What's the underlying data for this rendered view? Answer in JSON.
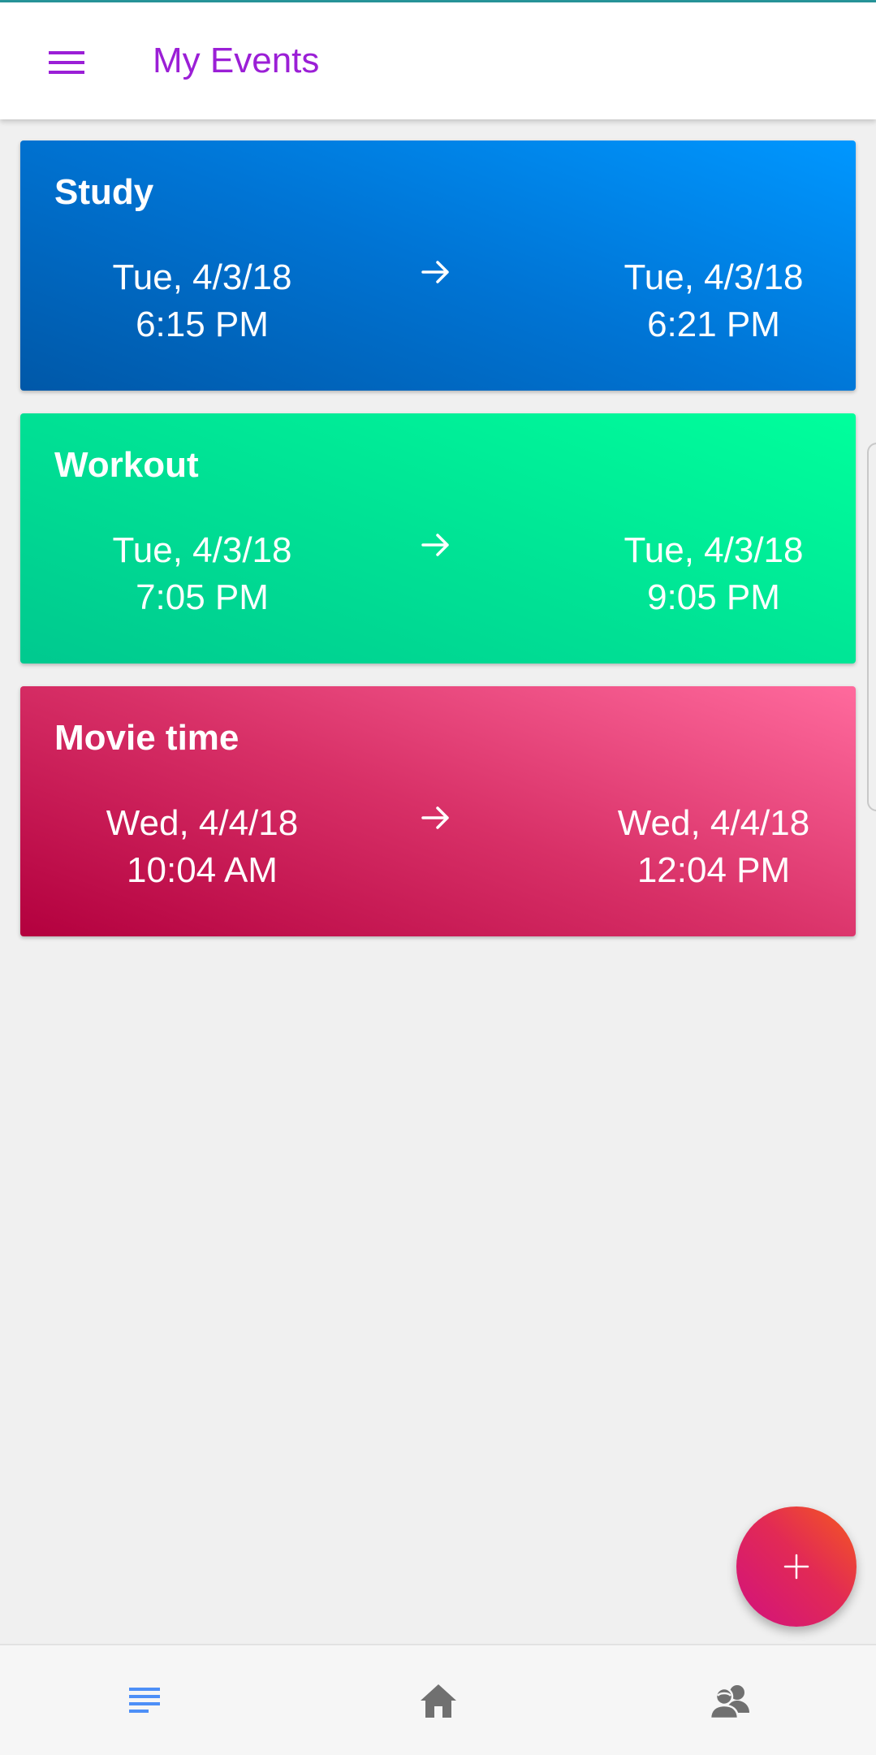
{
  "app_bar": {
    "title": "My Events",
    "menu_icon": "hamburger-menu-icon",
    "title_color": "#9b1fd6"
  },
  "events": [
    {
      "title": "Study",
      "start_date": "Tue, 4/3/18",
      "start_time": "6:15 PM",
      "end_date": "Tue, 4/3/18",
      "end_time": "6:21 PM",
      "colors": [
        "#0058a8",
        "#0097ff"
      ]
    },
    {
      "title": "Workout",
      "start_date": "Tue, 4/3/18",
      "start_time": "7:05 PM",
      "end_date": "Tue, 4/3/18",
      "end_time": "9:05 PM",
      "colors": [
        "#00c98f",
        "#00ff9c"
      ]
    },
    {
      "title": "Movie time",
      "start_date": "Wed, 4/4/18",
      "start_time": "10:04 AM",
      "end_date": "Wed, 4/4/18",
      "end_time": "12:04 PM",
      "colors": [
        "#b3003e",
        "#ff6a9d"
      ]
    }
  ],
  "fab": {
    "icon": "plus-icon",
    "colors": [
      "#f55a1e",
      "#d1117e"
    ]
  },
  "bottom_nav": [
    {
      "name": "events-list",
      "icon": "list-icon",
      "active": true,
      "color": "#4d8ff7"
    },
    {
      "name": "home",
      "icon": "home-icon",
      "active": false,
      "color": "#707070"
    },
    {
      "name": "people",
      "icon": "people-icon",
      "active": false,
      "color": "#707070"
    }
  ]
}
